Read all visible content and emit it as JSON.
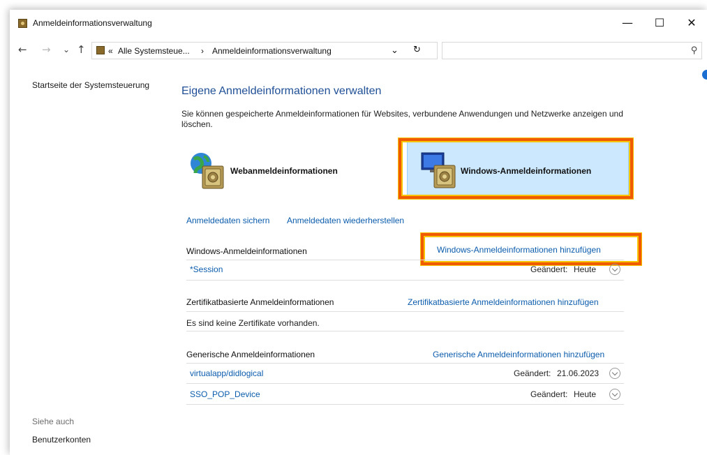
{
  "window": {
    "title": "Anmeldeinformationsverwaltung"
  },
  "window_controls": {
    "minimize": "—",
    "maximize": "☐",
    "close": "✕"
  },
  "nav": {
    "back": "←",
    "forward": "→",
    "recent": "⌄",
    "up": "↑",
    "refresh": "↻",
    "dropdown": "⌄"
  },
  "address": {
    "overflow": "«",
    "crumb1": "Alle Systemsteue...",
    "sep": "›",
    "crumb2": "Anmeldeinformationsverwaltung"
  },
  "search": {
    "placeholder": "",
    "icon": "⚲"
  },
  "sidebar": {
    "home": "Startseite der Systemsteuerung",
    "see_also": "Siehe auch",
    "user_accounts": "Benutzerkonten"
  },
  "main": {
    "heading": "Eigene Anmeldeinformationen verwalten",
    "description": "Sie können gespeicherte Anmeldeinformationen für Websites, verbundene Anwendungen und Netzwerke anzeigen und löschen.",
    "tiles": {
      "web": "Webanmeldeinformationen",
      "windows": "Windows-Anmeldeinformationen"
    },
    "backup_link": "Anmeldedaten sichern",
    "restore_link": "Anmeldedaten wiederherstellen",
    "sections": {
      "windows": {
        "title": "Windows-Anmeldeinformationen",
        "add": "Windows-Anmeldeinformationen hinzufügen",
        "entries": [
          {
            "name": "*Session",
            "changed_label": "Geändert:",
            "changed_value": "Heute"
          }
        ]
      },
      "cert": {
        "title": "Zertifikatbasierte Anmeldeinformationen",
        "add": "Zertifikatbasierte Anmeldeinformationen hinzufügen",
        "empty": "Es sind keine Zertifikate vorhanden."
      },
      "generic": {
        "title": "Generische Anmeldeinformationen",
        "add": "Generische Anmeldeinformationen hinzufügen",
        "entries": [
          {
            "name": "virtualapp/didlogical",
            "changed_label": "Geändert:",
            "changed_value": "21.06.2023"
          },
          {
            "name": "SSO_POP_Device",
            "changed_label": "Geändert:",
            "changed_value": "Heute"
          }
        ]
      }
    }
  },
  "colors": {
    "link": "#0b5cad",
    "heading": "#1f4f96",
    "highlight": "#f05a00",
    "highlight_inner": "#f7c400",
    "tile_selected": "#cce8ff"
  },
  "icons": {
    "app": "credential-manager-icon",
    "web_tile": "globe-vault-icon",
    "windows_tile": "monitor-vault-icon",
    "help": "help-icon"
  }
}
